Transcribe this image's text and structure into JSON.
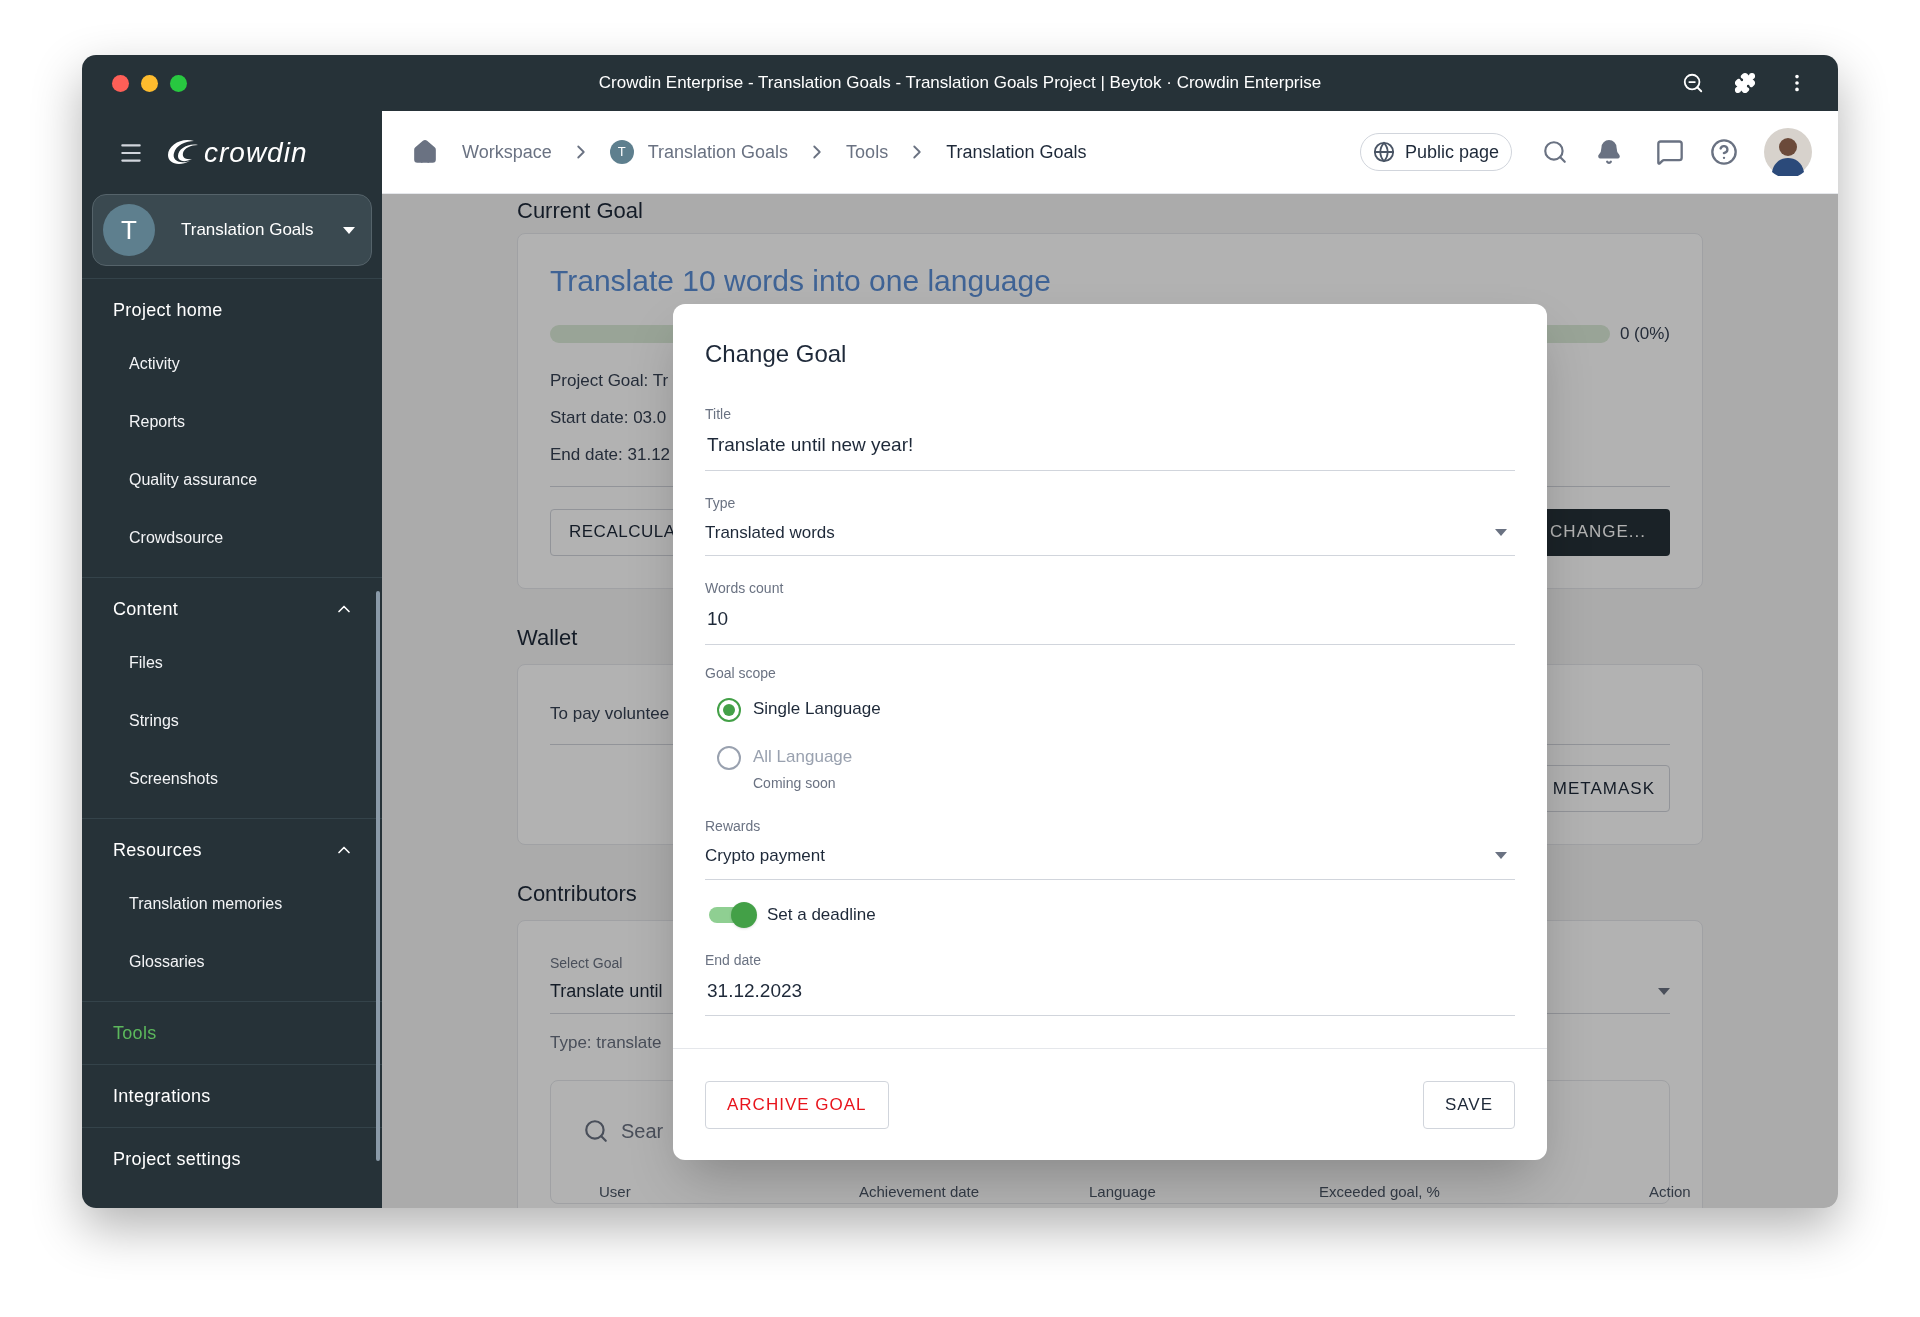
{
  "window": {
    "title": "Crowdin Enterprise - Translation Goals - Translation Goals Project | Beytok · Crowdin Enterprise"
  },
  "sidebar": {
    "logo": "crowdin",
    "project": {
      "initial": "T",
      "name": "Translation Goals"
    },
    "items": [
      {
        "kind": "link",
        "label": "Project home",
        "selected": false,
        "children": [
          {
            "label": "Activity",
            "selected": false
          },
          {
            "label": "Reports",
            "selected": false
          },
          {
            "label": "Quality assurance",
            "selected": false
          },
          {
            "label": "Crowdsource",
            "selected": false
          }
        ]
      },
      {
        "kind": "group",
        "label": "Content",
        "expanded": true,
        "selected": false,
        "children": [
          {
            "label": "Files",
            "selected": false
          },
          {
            "label": "Strings",
            "selected": false
          },
          {
            "label": "Screenshots",
            "selected": false
          }
        ]
      },
      {
        "kind": "group",
        "label": "Resources",
        "expanded": true,
        "selected": false,
        "children": [
          {
            "label": "Translation memories",
            "selected": false
          },
          {
            "label": "Glossaries",
            "selected": false
          }
        ]
      },
      {
        "kind": "link",
        "label": "Tools",
        "selected": true
      },
      {
        "kind": "link",
        "label": "Integrations",
        "selected": false
      },
      {
        "kind": "link",
        "label": "Project settings",
        "selected": false
      }
    ]
  },
  "header": {
    "breadcrumbs": [
      {
        "label": "Workspace",
        "selected": false
      },
      {
        "label": "Translation Goals",
        "badge": "T",
        "selected": false
      },
      {
        "label": "Tools",
        "selected": false
      },
      {
        "label": "Translation Goals",
        "selected": true
      }
    ],
    "public_page": "Public page"
  },
  "current_goal": {
    "heading": "Current Goal",
    "title": "Translate 10 words into one language",
    "progress": {
      "level": 0,
      "reading": "0 (0%)"
    },
    "lines": [
      "Project Goal: Tr",
      "Start date: 03.0",
      "End date: 31.12"
    ],
    "left_button": "RECALCULA",
    "right_button": "CHANGE..."
  },
  "wallet": {
    "heading": "Wallet",
    "text": "To pay voluntee",
    "button": "METAMASK"
  },
  "contributors": {
    "heading": "Contributors",
    "select_label": "Select Goal",
    "select_value": "Translate until",
    "type_text": "Type: translate",
    "search_placeholder": "Sear",
    "columns": [
      "User",
      "Achievement date",
      "Language",
      "Exceeded goal, %",
      "Action"
    ]
  },
  "modal": {
    "title": "Change Goal",
    "fields": [
      {
        "kind": "text",
        "label": "Title",
        "value": "Translate until new year!"
      },
      {
        "kind": "select",
        "label": "Type",
        "value": "Translated words"
      },
      {
        "kind": "text",
        "label": "Words count",
        "value": "10"
      },
      {
        "kind": "radio",
        "label": "Goal scope",
        "options": [
          {
            "label": "Single Language",
            "selected": true,
            "disabled": false
          },
          {
            "label": "All Language",
            "selected": false,
            "disabled": true,
            "hint": "Coming soon"
          }
        ]
      },
      {
        "kind": "select",
        "label": "Rewards",
        "value": "Crypto payment"
      },
      {
        "kind": "switch",
        "label": "Set a deadline",
        "on": true
      },
      {
        "kind": "text",
        "label": "End date",
        "value": "31.12.2023"
      }
    ],
    "archive_button": "ARCHIVE GOAL",
    "save_button": "SAVE"
  }
}
